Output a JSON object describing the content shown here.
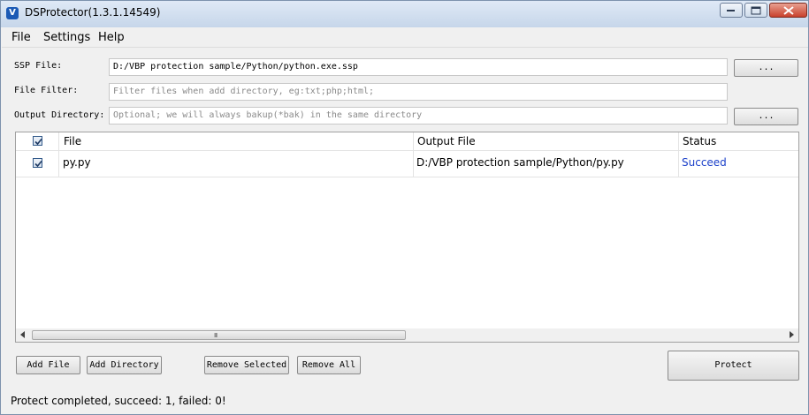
{
  "window": {
    "title": "DSProtector(1.3.1.14549)",
    "icon_letter": "V"
  },
  "menu": {
    "items": [
      "File",
      "Settings",
      "Help"
    ]
  },
  "form": {
    "ssp_label": "SSP File:",
    "ssp_value": "D:/VBP protection sample/Python/python.exe.ssp",
    "filter_label": "File Filter:",
    "filter_placeholder": "Filter files when add directory, eg:txt;php;html;",
    "output_label": "Output Directory:",
    "output_placeholder": "Optional; we will always bakup(*bak) in the same directory",
    "browse_label": "..."
  },
  "table": {
    "columns": [
      "File",
      "Output File",
      "Status"
    ],
    "header_checked": true,
    "rows": [
      {
        "checked": true,
        "file": "py.py",
        "output": "D:/VBP protection sample/Python/py.py",
        "status": "Succeed"
      }
    ],
    "scroll_grip": "III"
  },
  "buttons": {
    "add_file": "Add File",
    "add_directory": "Add Directory",
    "remove_selected": "Remove Selected",
    "remove_all": "Remove All",
    "protect": "Protect"
  },
  "status_bar": {
    "text": "Protect completed, succeed: 1, failed: 0!"
  },
  "colors": {
    "succeed": "#1a3fc9",
    "app_icon": "#1c5ab5",
    "close_button": "#c9412c"
  }
}
